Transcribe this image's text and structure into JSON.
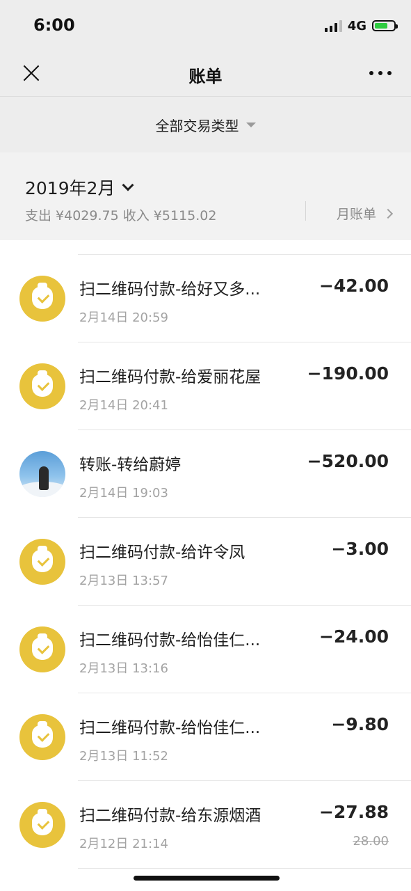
{
  "status_bar": {
    "time": "6:00",
    "network": "4G"
  },
  "header": {
    "title": "账单"
  },
  "filter": {
    "label": "全部交易类型"
  },
  "summary": {
    "month": "2019年2月",
    "totals": "支出 ¥4029.75 收入 ¥5115.02",
    "monthly_bill": "月账单"
  },
  "transactions": [
    {
      "title": "扫二维码付款-给好又多...",
      "time": "2月14日 20:59",
      "amount": "−42.00",
      "icon": "wallet-bag-icon"
    },
    {
      "title": "扫二维码付款-给爱丽花屋",
      "time": "2月14日 20:41",
      "amount": "−190.00",
      "icon": "wallet-bag-icon"
    },
    {
      "title": "转账-转给蔚婷",
      "time": "2月14日 19:03",
      "amount": "−520.00",
      "icon": "contact-avatar"
    },
    {
      "title": "扫二维码付款-给许令凤",
      "time": "2月13日 13:57",
      "amount": "−3.00",
      "icon": "wallet-bag-icon"
    },
    {
      "title": "扫二维码付款-给怡佳仁...",
      "time": "2月13日 13:16",
      "amount": "−24.00",
      "icon": "wallet-bag-icon"
    },
    {
      "title": "扫二维码付款-给怡佳仁...",
      "time": "2月13日 11:52",
      "amount": "−9.80",
      "icon": "wallet-bag-icon"
    },
    {
      "title": "扫二维码付款-给东源烟酒",
      "time": "2月12日 21:14",
      "amount": "−27.88",
      "original_amount": "28.00",
      "icon": "wallet-bag-icon"
    }
  ],
  "colors": {
    "payment_icon": "#e8c33c",
    "background": "#ededed"
  }
}
